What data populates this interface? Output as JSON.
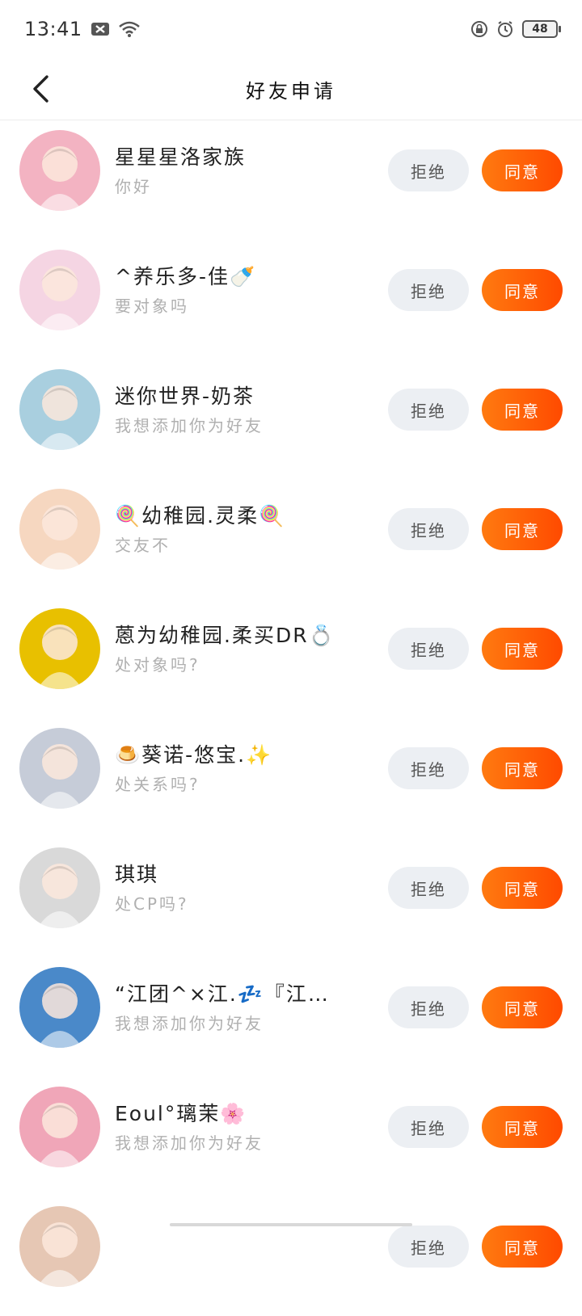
{
  "status": {
    "time": "13:41",
    "battery": "48",
    "left_icons": [
      "close-box-icon",
      "wifi-icon"
    ],
    "right_icons": [
      "lock-rotation-icon",
      "alarm-icon",
      "battery-icon"
    ]
  },
  "header": {
    "title": "好友申请",
    "back_icon": "back-chevron-icon"
  },
  "buttons": {
    "reject_label": "拒绝",
    "accept_label": "同意"
  },
  "colors": {
    "accent_start": "#ff7a10",
    "accent_end": "#ff4a00",
    "reject_bg": "#eceff3",
    "secondary_text": "#b0b0b0"
  },
  "requests": [
    {
      "name": "星星星洛家族",
      "message": "你好",
      "avatar_color": "#f3b3c2"
    },
    {
      "name": "^养乐多-佳🍼",
      "message": "要对象吗",
      "avatar_color": "#f5d5e3"
    },
    {
      "name": "迷你世界-奶茶",
      "message": "我想添加你为好友",
      "avatar_color": "#a9cfdf"
    },
    {
      "name": "🍭幼稚园.灵柔🍭",
      "message": "交友不",
      "avatar_color": "#f6d7c0"
    },
    {
      "name": "蒽为幼稚园.柔买DR💍",
      "message": "处对象吗?",
      "avatar_color": "#e8c000"
    },
    {
      "name": "🍮葵诺-悠宝.✨",
      "message": "处关系吗?",
      "avatar_color": "#c6ccd8"
    },
    {
      "name": "琪琪",
      "message": "处CP吗?",
      "avatar_color": "#d9d9d9"
    },
    {
      "name": "“江团^×江.💤『江…",
      "message": "我想添加你为好友",
      "avatar_color": "#4a89c9"
    },
    {
      "name": "Eoul°璃茉🌸",
      "message": "我想添加你为好友",
      "avatar_color": "#f0a6b8"
    },
    {
      "name": "",
      "message": "",
      "avatar_color": "#e6c7b4"
    }
  ]
}
